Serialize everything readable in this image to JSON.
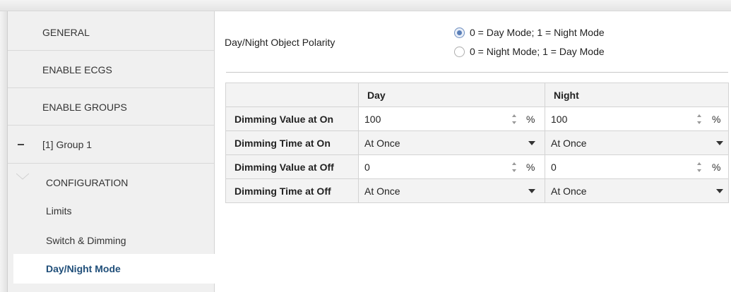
{
  "sidebar": {
    "items": [
      {
        "label": "GENERAL"
      },
      {
        "label": "ENABLE ECGS"
      },
      {
        "label": "ENABLE GROUPS"
      },
      {
        "label": "[1] Group 1"
      }
    ],
    "sub_items": [
      {
        "label": "CONFIGURATION"
      },
      {
        "label": "Limits"
      },
      {
        "label": "Switch & Dimming"
      },
      {
        "label": "Day/Night Mode",
        "selected": true
      }
    ]
  },
  "polarity": {
    "label": "Day/Night Object Polarity",
    "options": [
      {
        "label": "0 = Day Mode; 1 = Night Mode",
        "checked": true
      },
      {
        "label": "0 = Night Mode; 1 = Day Mode",
        "checked": false
      }
    ]
  },
  "table": {
    "columns": [
      "Day",
      "Night"
    ],
    "rows": [
      {
        "label": "Dimming Value at On",
        "type": "number",
        "day": "100",
        "night": "100",
        "unit": "%"
      },
      {
        "label": "Dimming Time at On",
        "type": "select",
        "day": "At Once",
        "night": "At Once"
      },
      {
        "label": "Dimming Value at Off",
        "type": "number",
        "day": "0",
        "night": "0",
        "unit": "%"
      },
      {
        "label": "Dimming Time at Off",
        "type": "select",
        "day": "At Once",
        "night": "At Once"
      }
    ]
  },
  "colors": {
    "selected_text": "#1f4e79",
    "sidebar_bg": "#f0f0f0",
    "radio_checked": "#5a7fb8"
  }
}
